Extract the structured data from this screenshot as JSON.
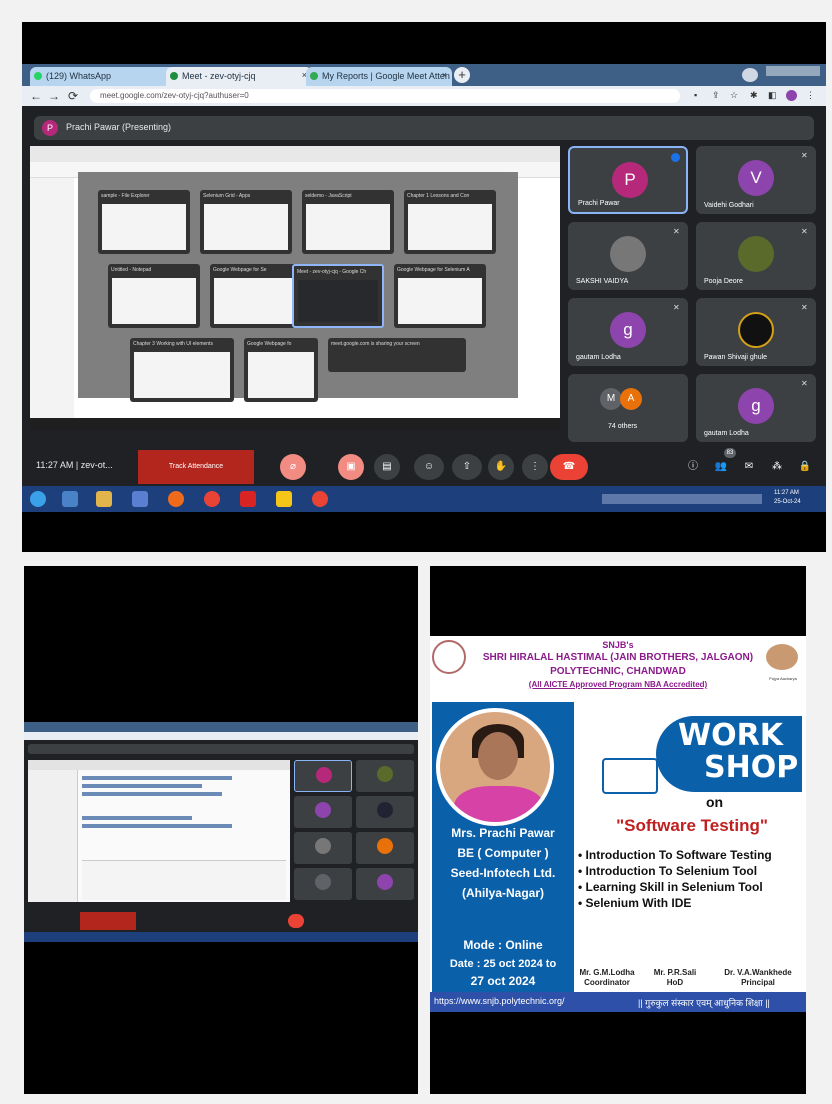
{
  "browser": {
    "tabs": [
      {
        "label": "(129) WhatsApp",
        "color": "#25d366"
      },
      {
        "label": "Meet - zev-otyj-cjq",
        "color": "#1e8e3e"
      },
      {
        "label": "My Reports | Google Meet Atten",
        "color": "#34a853"
      }
    ],
    "url": "meet.google.com/zev-otyj-cjq?authuser=0"
  },
  "meet": {
    "presenting_label": "Prachi Pawar (Presenting)",
    "presenter_initial": "P",
    "time": "11:27 AM",
    "meeting_code": "zev-ot...",
    "track_attendance": "Track Attendance",
    "participants": [
      {
        "name": "Prachi Pawar",
        "initial": "P",
        "color": "#b5287a"
      },
      {
        "name": "Vaidehi Godhari",
        "initial": "V",
        "color": "#8e44ad"
      },
      {
        "name": "SAKSHI VAIDYA",
        "initial": "",
        "color": "#555"
      },
      {
        "name": "Pooja Deore",
        "initial": "",
        "color": "#5a6a2a"
      },
      {
        "name": "gautam Lodha",
        "initial": "g",
        "color": "#8e44ad"
      },
      {
        "name": "Pawan Shivaji ghule",
        "initial": "",
        "color": "#2a2a2a"
      },
      {
        "name": "74 others",
        "initial": "M",
        "color": "#5f6368"
      },
      {
        "name": "gautam Lodha",
        "initial": "g",
        "color": "#8e44ad"
      }
    ],
    "bottom_badge": "83",
    "windows": [
      "sample - File Explorer",
      "Selenium Grid - Apps",
      "seldemo - JavaScript",
      "Chapter 1 Lessons and Con",
      "Untitled - Notepad",
      "Google Webpage for Se",
      "Meet - zev-otyj-cjq - Google Ch",
      "Google Webpage for Selenium A",
      "Chapter 3 Working with UI elements",
      "Google Webpage fo",
      "meet.google.com is sharing your screen"
    ]
  },
  "taskbar": {
    "clock_time": "11:27 AM",
    "clock_date": "25-Oct-24"
  },
  "poster": {
    "org_line1": "SNJB's",
    "org_line2": "SHRI HIRALAL HASTIMAL (JAIN BROTHERS, JALGAON)",
    "org_line3": "POLYTECHNIC, CHANDWAD",
    "org_line4": "(All AICTE Approved Program NBA Accredited)",
    "founder": "Pujya Aacharya",
    "speaker": [
      "Mrs. Prachi Pawar",
      "BE ( Computer )",
      "Seed-Infotech Ltd.",
      "(Ahilya-Nagar)"
    ],
    "work": "WORK",
    "shop": "SHOP",
    "on": "on",
    "topic": "\"Software Testing\"",
    "bullets": [
      "• Introduction To Software Testing",
      "• Introduction To Selenium Tool",
      "• Learning Skill in Selenium Tool",
      "• Selenium With IDE"
    ],
    "mode": "Mode : Online",
    "date1": "Date : 25 oct 2024 to",
    "date2": "27 oct 2024",
    "signatories": [
      {
        "name": "Mr. G.M.Lodha",
        "role": "Coordinator"
      },
      {
        "name": "Mr. P.R.Sali",
        "role": "HoD"
      },
      {
        "name": "Dr. V.A.Wankhede",
        "role": "Principal"
      }
    ],
    "website": "https://www.snjb.polytechnic.org/",
    "motto": "|| गुरुकुल संस्कार एवम् आधुनिक शिक्षा ||"
  }
}
